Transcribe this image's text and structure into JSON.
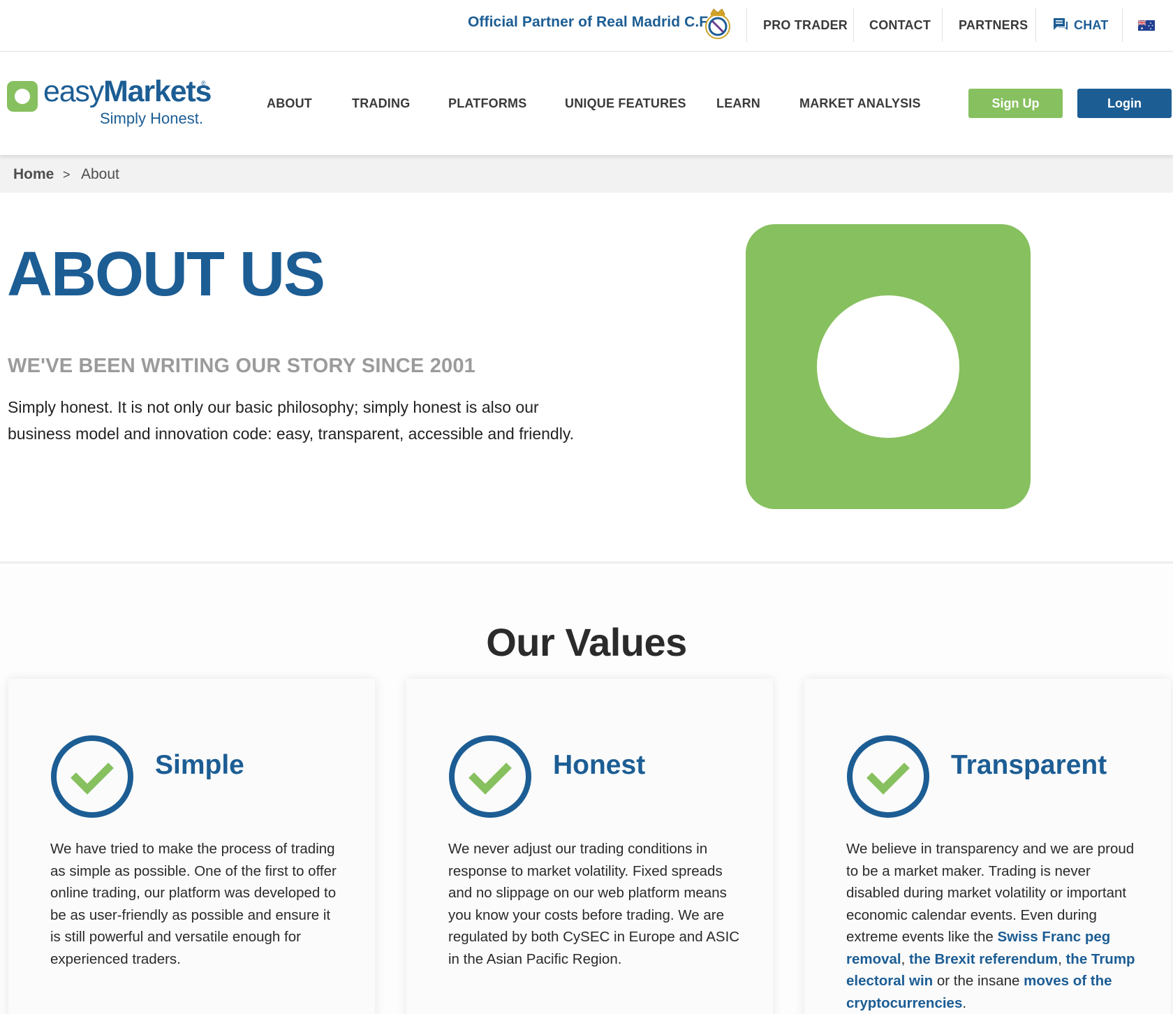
{
  "topbar": {
    "partner_text": "Official Partner of Real Madrid C.F.",
    "pro_trader": "PRO TRADER",
    "contact": "CONTACT",
    "partners": "PARTNERS",
    "chat": "CHAT"
  },
  "logo": {
    "word_light": "easy",
    "word_bold": "Markets",
    "registered": "®",
    "tagline": "Simply Honest."
  },
  "nav": {
    "items": [
      "ABOUT",
      "TRADING",
      "PLATFORMS",
      "UNIQUE FEATURES",
      "LEARN",
      "MARKET ANALYSIS"
    ],
    "signup": "Sign Up",
    "login": "Login"
  },
  "breadcrumb": {
    "home": "Home",
    "separator": ">",
    "current": "About"
  },
  "hero": {
    "title": "ABOUT US",
    "subtitle": "WE'VE BEEN WRITING OUR STORY SINCE 2001",
    "body": "Simply honest. It is not only our basic philosophy; simply honest is also our business model and innovation code: easy, transparent, accessible and friendly."
  },
  "values": {
    "title": "Our Values",
    "cards": [
      {
        "title": "Simple",
        "text": "We have tried to make the process of trading as simple as possible. One of the first to offer online trading, our platform was developed to be as user-friendly as possible and ensure it is still powerful and versatile enough for experienced traders."
      },
      {
        "title": "Honest",
        "text": "We never adjust our trading conditions in response to market volatility. Fixed spreads and no slippage on our web platform means you know your costs before trading. We are regulated by both CySEC in Europe and ASIC in the Asian Pacific Region."
      },
      {
        "title": "Transparent",
        "text_1": "We believe in transparency and we are proud to be a market maker. Trading is never disabled during market volatility or important economic calendar events. Even during extreme events like the ",
        "link_1": "Swiss Franc peg removal",
        "sep_1": ", ",
        "link_2": "the Brexit referendum",
        "sep_2": ", ",
        "link_3": "the Trump electoral win",
        "text_2": " or the insane ",
        "link_4": "moves of the cryptocurrencies",
        "text_3": "."
      }
    ]
  },
  "colors": {
    "brand_blue": "#1c5d94",
    "brand_green": "#87c05f",
    "breadcrumb_bg": "#f2f2f2"
  },
  "icons": {
    "crest": "real-madrid-crest-icon",
    "chat": "chat-bubble-icon",
    "flag": "australia-flag-icon",
    "check": "check-circle-icon"
  }
}
